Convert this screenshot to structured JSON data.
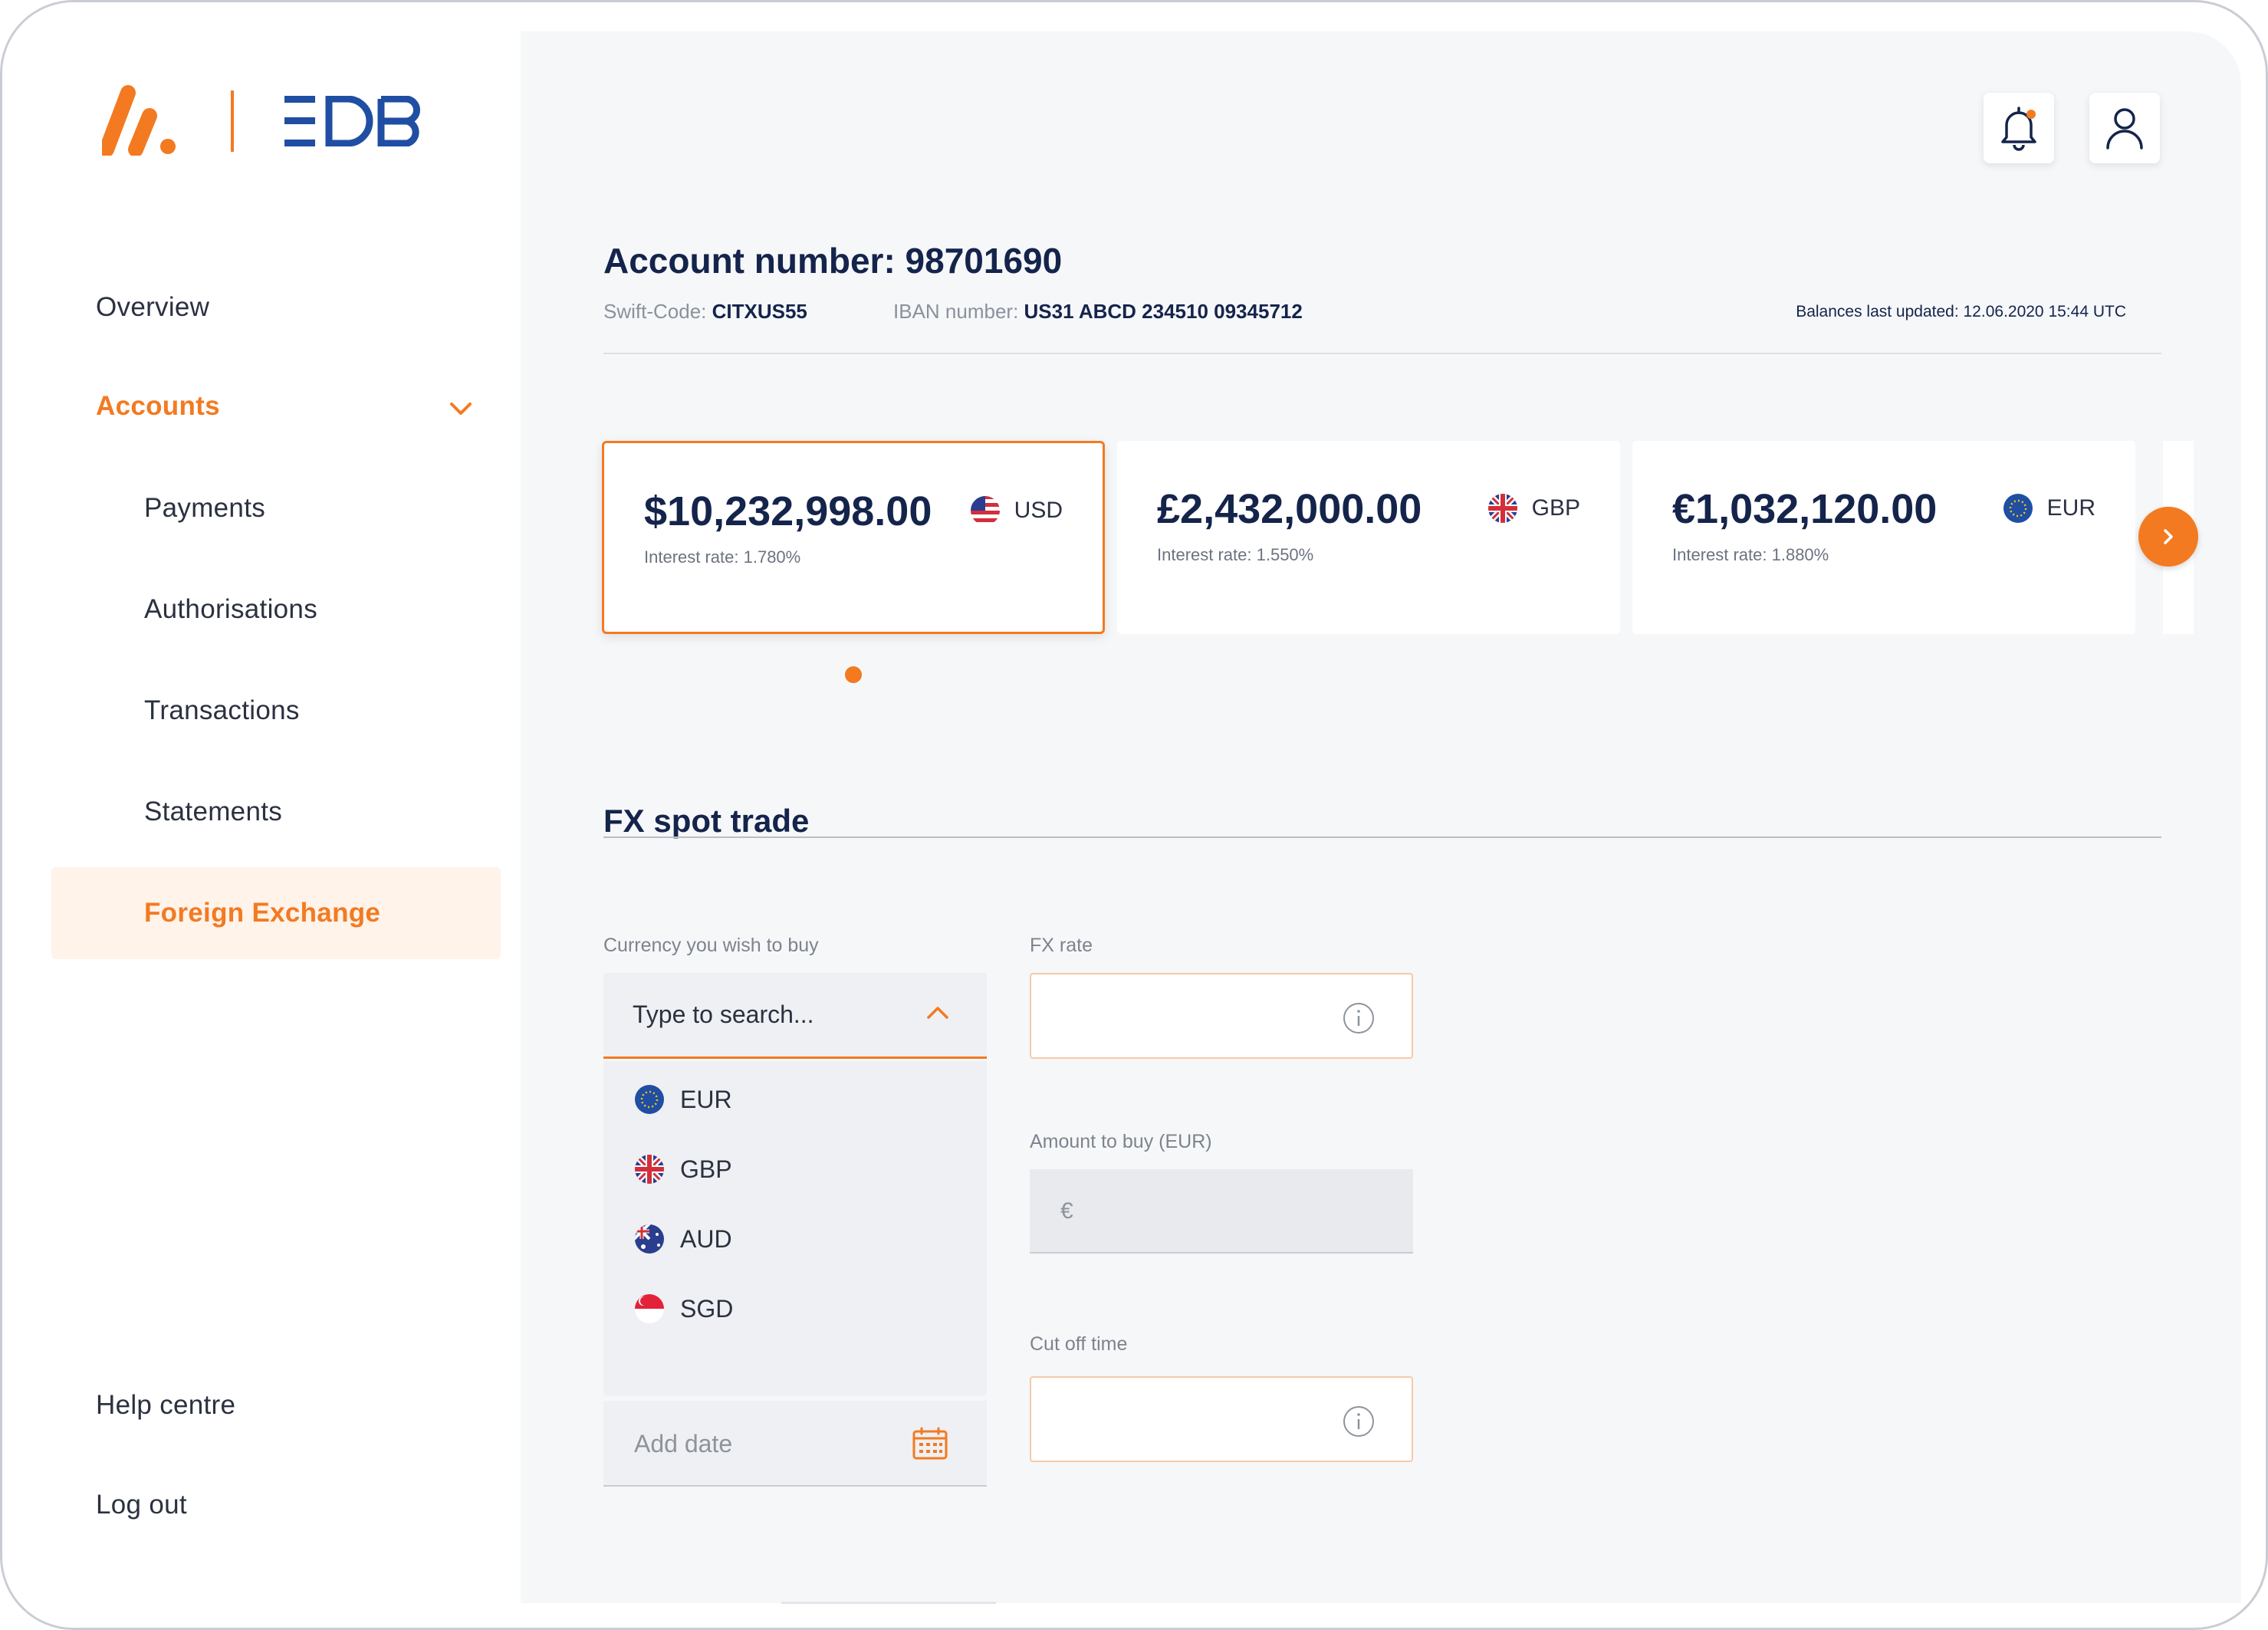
{
  "brand": {
    "logo_text": "EDB",
    "accent_color": "#f37a21",
    "navy_color": "#1f4ea3"
  },
  "sidebar": {
    "items": [
      {
        "label": "Overview"
      },
      {
        "label": "Accounts"
      },
      {
        "label": "Payments"
      },
      {
        "label": "Authorisations"
      },
      {
        "label": "Transactions"
      },
      {
        "label": "Statements"
      },
      {
        "label": "Foreign Exchange"
      }
    ],
    "footer": [
      {
        "label": "Help centre"
      },
      {
        "label": "Log out"
      }
    ]
  },
  "header": {
    "notification_icon": "bell-icon",
    "profile_icon": "user-icon"
  },
  "account": {
    "title": "Account number: 98701690",
    "swift_label": "Swift-Code:",
    "swift_value": "CITXUS55",
    "iban_label": "IBAN number:",
    "iban_value": "US31 ABCD 234510 09345712",
    "updated": "Balances last updated:  12.06.2020  15:44 UTC"
  },
  "balances": [
    {
      "amount": "$10,232,998.00",
      "rate": "Interest rate: 1.780%",
      "currency": "USD",
      "flag": "us-flag-icon"
    },
    {
      "amount": "£2,432,000.00",
      "rate": "Interest rate: 1.550%",
      "currency": "GBP",
      "flag": "uk-flag-icon"
    },
    {
      "amount": "€1,032,120.00",
      "rate": "Interest rate: 1.880%",
      "currency": "EUR",
      "flag": "eu-flag-icon"
    }
  ],
  "fx": {
    "title": "FX spot trade",
    "buy_label": "Currency you wish to buy",
    "buy_placeholder": "Type to search...",
    "options": [
      "EUR",
      "GBP",
      "AUD",
      "SGD"
    ],
    "date_placeholder": "Add date",
    "rate_label": "FX rate",
    "amount_label": "Amount to buy (EUR)",
    "amount_prefix": "€",
    "cutoff_label": "Cut off time"
  }
}
